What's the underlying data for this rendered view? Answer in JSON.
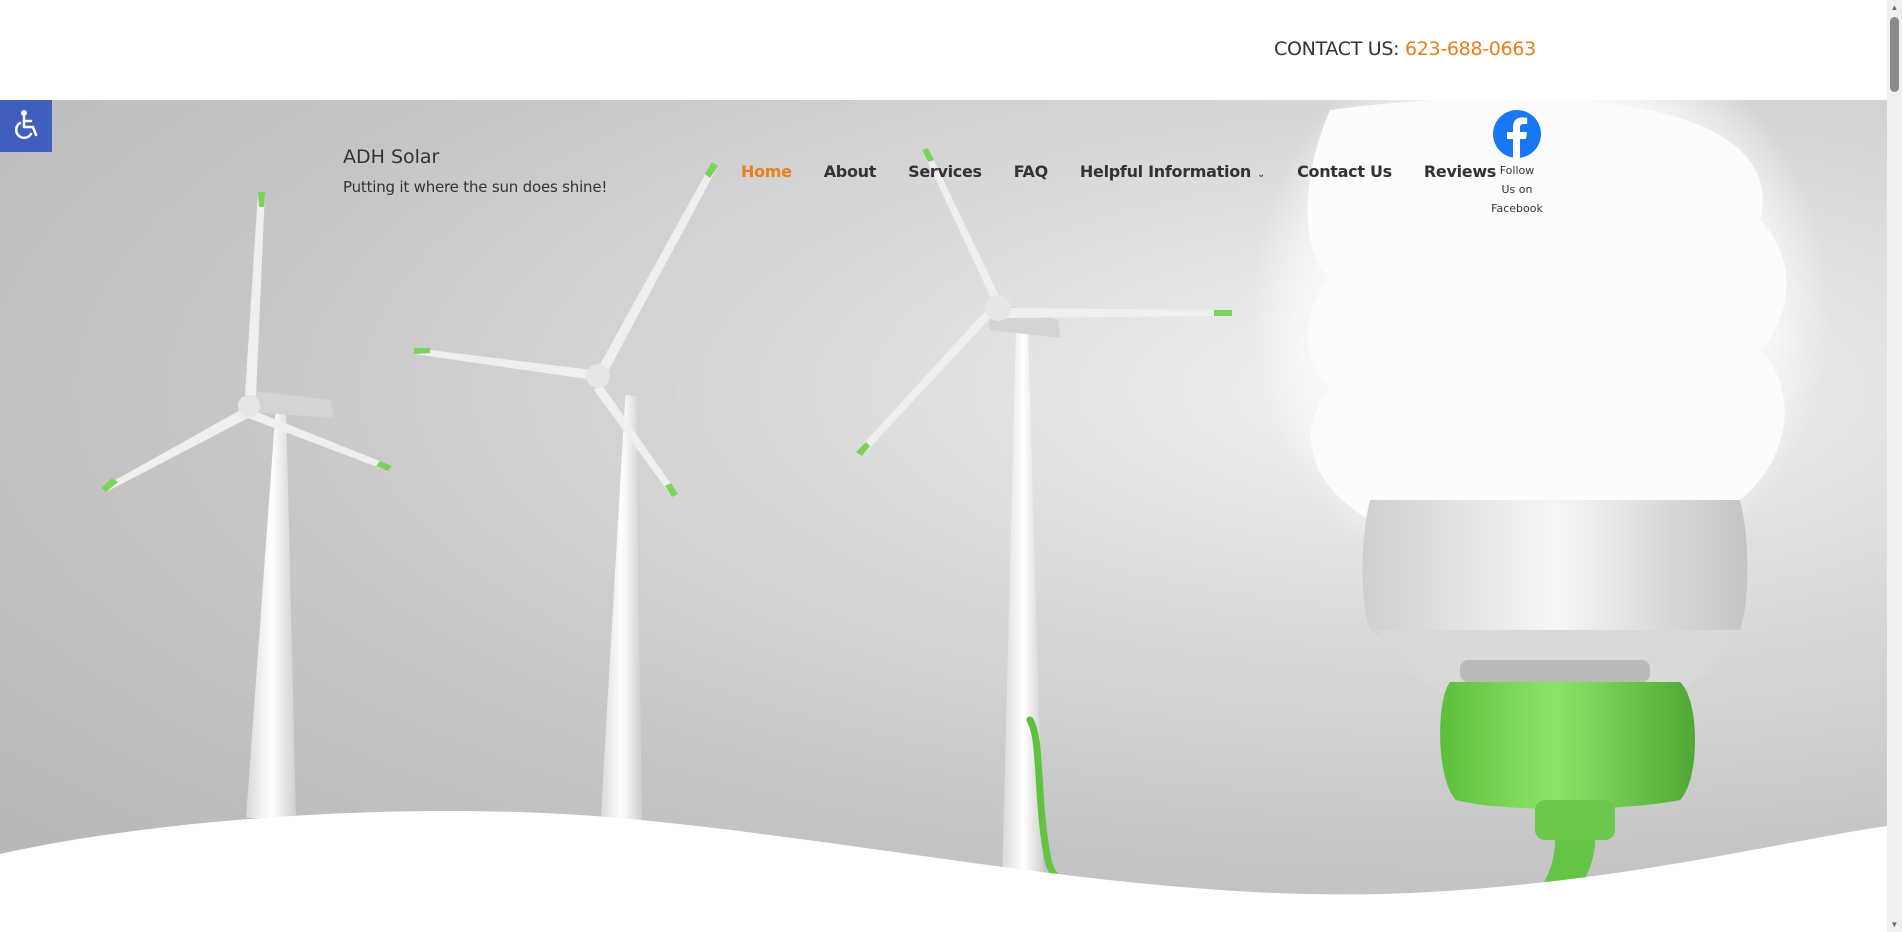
{
  "topbar": {
    "contact_label": "CONTACT US: ",
    "phone": "623-688-0663"
  },
  "brand": {
    "title": "ADH Solar",
    "tagline": "Putting it where the sun does shine!"
  },
  "nav": {
    "items": [
      {
        "label": "Home",
        "active": true
      },
      {
        "label": "About"
      },
      {
        "label": "Services"
      },
      {
        "label": "FAQ"
      },
      {
        "label": "Helpful Information",
        "has_dropdown": true
      },
      {
        "label": "Contact Us"
      },
      {
        "label": "Reviews"
      }
    ]
  },
  "social": {
    "facebook_line1": "Follow",
    "facebook_line2": "Us on",
    "facebook_line3": "Facebook",
    "icon": "facebook-icon"
  },
  "accessibility": {
    "icon": "wheelchair-icon"
  },
  "colors": {
    "accent": "#e87e1e",
    "accessibility_bg": "#3f5fbf",
    "facebook": "#1877f2",
    "green": "#7cd35a"
  }
}
